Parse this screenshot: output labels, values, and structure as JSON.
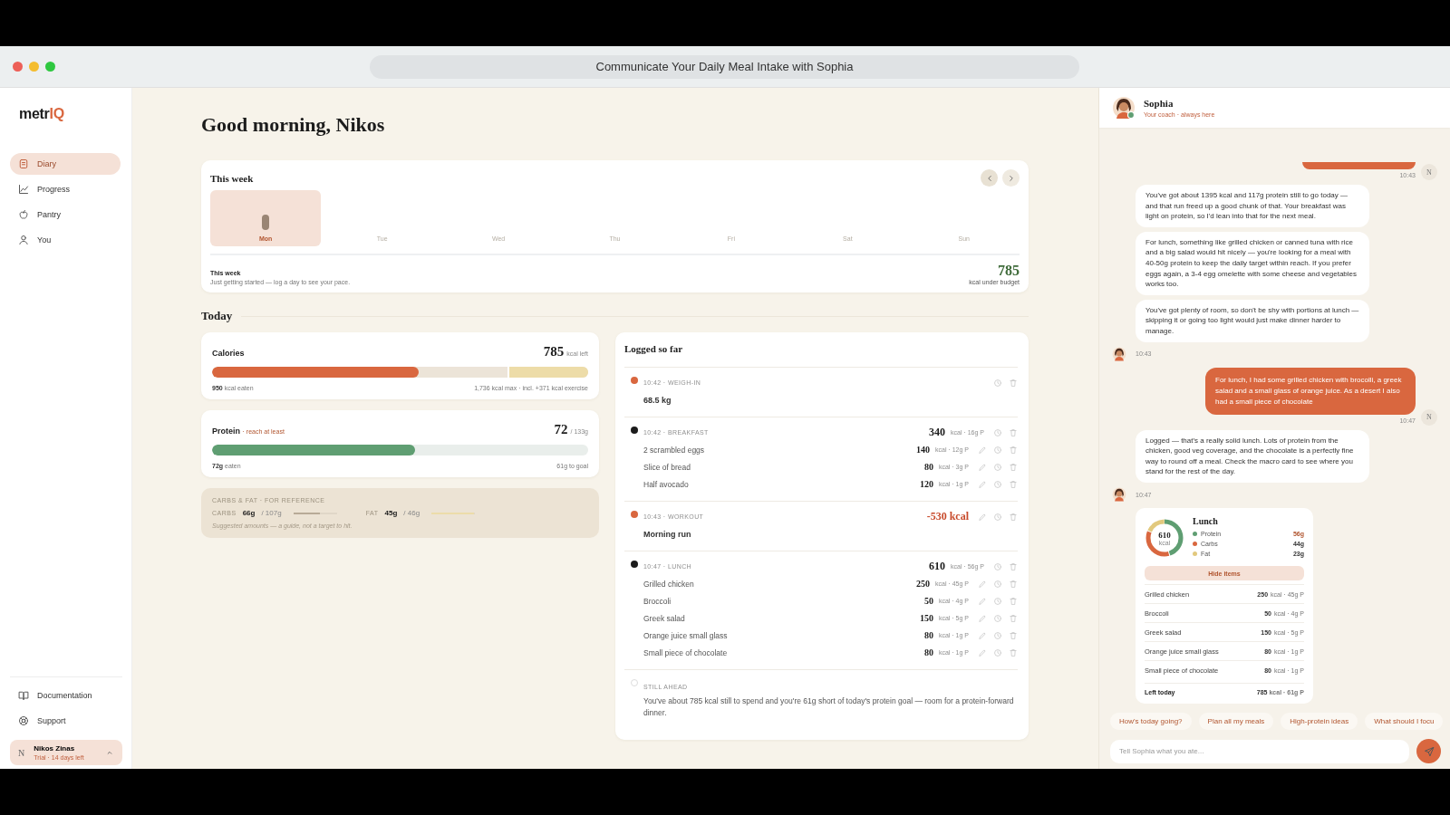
{
  "browser": {
    "title": "Communicate Your Daily Meal Intake with Sophia"
  },
  "sidebar": {
    "logo_prefix": "metr",
    "logo_accent": "IQ",
    "nav": [
      {
        "label": "Diary",
        "kind": "diary",
        "selected": true
      },
      {
        "label": "Progress",
        "kind": "progress",
        "selected": false
      },
      {
        "label": "Pantry",
        "kind": "pantry",
        "selected": false
      },
      {
        "label": "You",
        "kind": "you",
        "selected": false
      }
    ],
    "footer_links": [
      {
        "label": "Documentation",
        "kind": "book"
      },
      {
        "label": "Support",
        "kind": "lifebuoy"
      }
    ],
    "user": {
      "initial": "N",
      "name": "Nikos Zinas",
      "plan": "Trial · 14 days left"
    }
  },
  "main": {
    "greeting": "Good morning, Nikos",
    "week": {
      "title": "This week",
      "days": [
        {
          "label": "Mon",
          "selected": true,
          "logged": true
        },
        {
          "label": "Tue",
          "selected": false,
          "logged": false
        },
        {
          "label": "Wed",
          "selected": false,
          "logged": false
        },
        {
          "label": "Thu",
          "selected": false,
          "logged": false
        },
        {
          "label": "Fri",
          "selected": false,
          "logged": false
        },
        {
          "label": "Sat",
          "selected": false,
          "logged": false
        },
        {
          "label": "Sun",
          "selected": false,
          "logged": false
        }
      ],
      "summary_title": "This week",
      "summary_text": "Just getting started — log a day to see your pace.",
      "value": "785",
      "value_caption": "kcal under budget"
    },
    "today_title": "Today",
    "calories": {
      "label": "Calories",
      "value": "785",
      "unit": "kcal left",
      "level": 0.55,
      "exercise": {
        "level": 0.21
      },
      "left": "**950** kcal eaten",
      "right": "1,736 kcal max · incl. +371 kcal exercise"
    },
    "protein": {
      "label": "Protein",
      "note": "· reach at least",
      "value": "72",
      "unit": "/ 133g",
      "level": 0.54,
      "left": "**72g** eaten",
      "right": "61g to goal"
    },
    "reference": {
      "title": "CARBS & FAT · FOR REFERENCE",
      "items": [
        {
          "label": "CARBS",
          "value": "66g",
          "target": "/ 107g",
          "level": 0.62,
          "color": "#b8aa97"
        },
        {
          "label": "FAT",
          "value": "45g",
          "target": "/ 46g",
          "level": 0.98,
          "color": "#ecdcaa"
        }
      ],
      "note": "Suggested amounts — a guide, not a target to hit."
    },
    "log": {
      "title": "Logged so far",
      "entries": [
        {
          "kind": "weigh",
          "meta": "10:42 · WEIGH-IN",
          "color": "#d9673f",
          "title": "68.5 kg",
          "editable": false
        },
        {
          "kind": "meal",
          "meta": "10:42 · BREAKFAST",
          "color": "#1c1c1c",
          "total": "340",
          "total_unit": "kcal · 16g P",
          "editable": false,
          "items": [
            {
              "name": "2 scrambled eggs",
              "kcal": "140",
              "detail": "kcal · 12g P"
            },
            {
              "name": "Slice of bread",
              "kcal": "80",
              "detail": "kcal · 3g P"
            },
            {
              "name": "Half avocado",
              "kcal": "120",
              "detail": "kcal · 1g P"
            }
          ]
        },
        {
          "kind": "workout",
          "meta": "10:43 · WORKOUT",
          "color": "#d9673f",
          "title": "Morning run",
          "total": "-530 kcal",
          "editable": true
        },
        {
          "kind": "meal",
          "meta": "10:47 · LUNCH",
          "color": "#1c1c1c",
          "total": "610",
          "total_unit": "kcal · 56g P",
          "editable": false,
          "items": [
            {
              "name": "Grilled chicken",
              "kcal": "250",
              "detail": "kcal · 45g P"
            },
            {
              "name": "Broccoli",
              "kcal": "50",
              "detail": "kcal · 4g P"
            },
            {
              "name": "Greek salad",
              "kcal": "150",
              "detail": "kcal · 5g P"
            },
            {
              "name": "Orange juice small glass",
              "kcal": "80",
              "detail": "kcal · 1g P"
            },
            {
              "name": "Small piece of chocolate",
              "kcal": "80",
              "detail": "kcal · 1g P"
            }
          ]
        }
      ],
      "ahead": {
        "title": "STILL AHEAD",
        "text": "You've about 785 kcal still to spend and you're 61g short of today's protein goal — room for a protein-forward dinner."
      }
    }
  },
  "chat": {
    "name": "Sophia",
    "subtitle": "Your coach · always here",
    "messages": [
      {
        "kind": "user",
        "time": "10:43",
        "initial": "N"
      },
      {
        "kind": "coach",
        "time": "10:43",
        "bubbles": [
          "You've got about 1395 kcal and 117g protein still to go today — and that run freed up a good chunk of that. Your breakfast was light on protein, so I'd lean into that for the next meal.",
          "For lunch, something like grilled chicken or canned tuna with rice and a big salad would hit nicely — you're looking for a meal with 40-50g protein to keep the daily target within reach. If you prefer eggs again, a 3-4 egg omelette with some cheese and vegetables works too.",
          "You've got plenty of room, so don't be shy with portions at lunch — skipping it or going too light would just make dinner harder to manage."
        ]
      },
      {
        "kind": "user",
        "time": "10:47",
        "initial": "N",
        "text": "For lunch, I had some grilled chicken with brocolli, a greek salad and a small glass of orange juice. As a desert I also had a small piece of chocolate"
      },
      {
        "kind": "coach",
        "time": "10:47",
        "bubbles": [
          "Logged — that's a really solid lunch. Lots of protein from the chicken, good veg coverage, and the chocolate is a perfectly fine way to round off a meal. Check the macro card to see where you stand for the rest of the day."
        ]
      },
      {
        "kind": "card",
        "title": "Lunch",
        "total": "610",
        "unit": "kcal",
        "button": "Hide items",
        "macros": [
          {
            "label": "Protein",
            "value": "56g",
            "color": "#5f9e72"
          },
          {
            "label": "Carbs",
            "value": "44g",
            "color": "#d9673f"
          },
          {
            "label": "Fat",
            "value": "23g",
            "color": "#e2c97e"
          }
        ],
        "items": [
          {
            "name": "Grilled chicken",
            "kcal": "250",
            "detail": "kcal · 45g P"
          },
          {
            "name": "Broccoli",
            "kcal": "50",
            "detail": "kcal · 4g P"
          },
          {
            "name": "Greek salad",
            "kcal": "150",
            "detail": "kcal · 5g P"
          },
          {
            "name": "Orange juice small glass",
            "kcal": "80",
            "detail": "kcal · 1g P"
          },
          {
            "name": "Small piece of chocolate",
            "kcal": "80",
            "detail": "kcal · 1g P"
          }
        ],
        "footer_label": "Left today",
        "footer_kcal": "785",
        "footer_detail": "kcal · 61g P"
      }
    ],
    "suggestions": [
      "How's today going?",
      "Plan all my meals",
      "High-protein ideas",
      "What should I focu"
    ],
    "input": {
      "placeholder": "Tell Sophia what you ate..."
    }
  }
}
